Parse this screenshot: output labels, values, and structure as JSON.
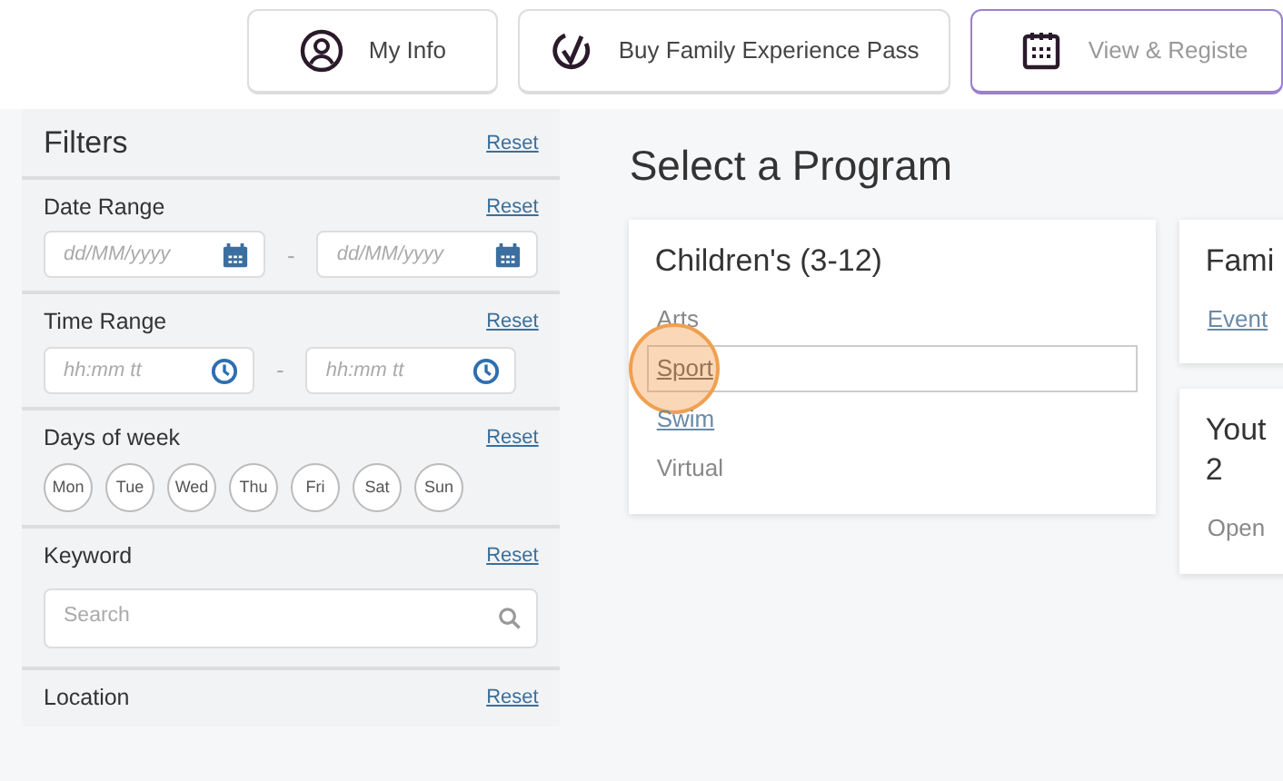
{
  "tabs": [
    {
      "label": "My Info",
      "selected": false
    },
    {
      "label": "Buy Family Experience Pass",
      "selected": false
    },
    {
      "label": "View & Registe",
      "selected": true
    }
  ],
  "filters": {
    "title": "Filters",
    "reset": "Reset",
    "sections": [
      {
        "kind": "range",
        "label": "Date Range",
        "reset": "Reset",
        "from": "dd/MM/yyyy",
        "to": "dd/MM/yyyy",
        "separator": "-"
      },
      {
        "kind": "range",
        "label": "Time Range",
        "reset": "Reset",
        "from": "hh:mm tt",
        "to": "hh:mm tt",
        "separator": "-"
      },
      {
        "kind": "days",
        "label": "Days of week",
        "reset": "Reset",
        "days": [
          {
            "label": "Mon",
            "selected": false
          },
          {
            "label": "Tue",
            "selected": false
          },
          {
            "label": "Wed",
            "selected": false
          },
          {
            "label": "Thu",
            "selected": false
          },
          {
            "label": "Fri",
            "selected": false
          },
          {
            "label": "Sat",
            "selected": false
          },
          {
            "label": "Sun",
            "selected": false
          }
        ]
      },
      {
        "kind": "search",
        "label": "Keyword",
        "reset": "Reset",
        "placeholder": "Search"
      },
      {
        "kind": "heading",
        "label": "Location",
        "reset": "Reset"
      }
    ]
  },
  "main": {
    "title": "Select a Program",
    "columns": [
      [
        {
          "title_lines": [
            "Children's (3-12)"
          ],
          "items": [
            {
              "label": "Arts",
              "kind": "text",
              "highlighted": false
            },
            {
              "label": "Sport",
              "kind": "link",
              "highlighted": true
            },
            {
              "label": "Swim",
              "kind": "link",
              "highlighted": false
            },
            {
              "label": "Virtual",
              "kind": "text",
              "highlighted": false
            }
          ]
        }
      ],
      [
        {
          "title_lines": [
            "Fami"
          ],
          "items": [
            {
              "label": "Event",
              "kind": "link",
              "highlighted": false
            }
          ]
        },
        {
          "title_lines": [
            "Yout",
            "2"
          ],
          "items": [
            {
              "label": "Open",
              "kind": "text",
              "highlighted": false
            }
          ]
        }
      ]
    ]
  }
}
